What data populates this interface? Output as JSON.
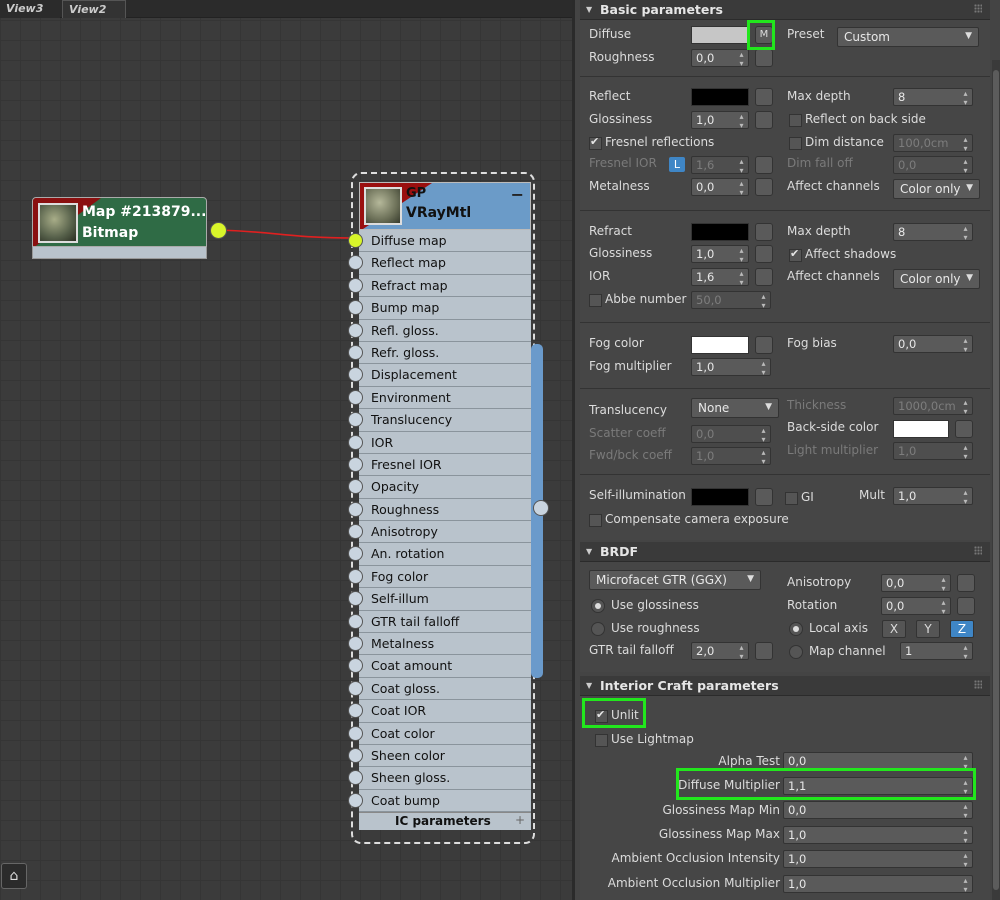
{
  "viewport_tabs": [
    "View3",
    "View2"
  ],
  "bitmap_node": {
    "title": "Map #213879...",
    "type": "Bitmap"
  },
  "vray_node": {
    "title": "GP",
    "type": "VRayMtl",
    "collapse_glyph": "−",
    "slots": [
      "Diffuse map",
      "Reflect map",
      "Refract map",
      "Bump map",
      "Refl. gloss.",
      "Refr. gloss.",
      "Displacement",
      "Environment",
      "Translucency",
      "IOR",
      "Fresnel IOR",
      "Opacity",
      "Roughness",
      "Anisotropy",
      "An. rotation",
      "Fog color",
      "Self-illum",
      "GTR tail falloff",
      "Metalness",
      "Coat amount",
      "Coat gloss.",
      "Coat IOR",
      "Coat color",
      "Sheen color",
      "Sheen gloss.",
      "Coat bump"
    ],
    "footer": "IC parameters",
    "footer_plus": "+"
  },
  "basic": {
    "title": "Basic parameters",
    "diffuse": "Diffuse",
    "m_button": "M",
    "preset": "Preset",
    "preset_value": "Custom",
    "roughness": "Roughness",
    "roughness_value": "0,0",
    "reflect": "Reflect",
    "max_depth": "Max depth",
    "max_depth_value": "8",
    "glossiness": "Glossiness",
    "glossiness_value": "1,0",
    "reflect_back": "Reflect on back side",
    "fresnel": "Fresnel reflections",
    "dim_distance": "Dim distance",
    "dim_distance_value": "100,0cm",
    "fresnel_ior": "Fresnel IOR",
    "l_button": "L",
    "fresnel_ior_value": "1,6",
    "dim_falloff": "Dim fall off",
    "dim_falloff_value": "0,0",
    "metalness": "Metalness",
    "metalness_value": "0,0",
    "affect_channels": "Affect channels",
    "affect_channels_value": "Color only",
    "refract": "Refract",
    "refr_max_depth": "Max depth",
    "refr_max_depth_value": "8",
    "refr_gloss": "Glossiness",
    "refr_gloss_value": "1,0",
    "affect_shadows": "Affect shadows",
    "ior": "IOR",
    "ior_value": "1,6",
    "refr_affect": "Affect channels",
    "refr_affect_value": "Color only",
    "abbe": "Abbe number",
    "abbe_value": "50,0",
    "fog_color": "Fog color",
    "fog_bias": "Fog bias",
    "fog_bias_value": "0,0",
    "fog_mult": "Fog multiplier",
    "fog_mult_value": "1,0",
    "translucency": "Translucency",
    "translucency_value": "None",
    "thickness": "Thickness",
    "thickness_value": "1000,0cm",
    "scatter": "Scatter coeff",
    "scatter_value": "0,0",
    "backside": "Back-side color",
    "fwdbck": "Fwd/bck coeff",
    "fwdbck_value": "1,0",
    "light_mult": "Light multiplier",
    "light_mult_value": "1,0",
    "self_illum": "Self-illumination",
    "gi": "GI",
    "mult": "Mult",
    "mult_value": "1,0",
    "compensate": "Compensate camera exposure"
  },
  "brdf": {
    "title": "BRDF",
    "type_value": "Microfacet GTR (GGX)",
    "anisotropy": "Anisotropy",
    "anisotropy_value": "0,0",
    "use_gloss": "Use glossiness",
    "rotation": "Rotation",
    "rotation_value": "0,0",
    "use_rough": "Use roughness",
    "local_axis": "Local axis",
    "x": "X",
    "y": "Y",
    "z": "Z",
    "gtr": "GTR tail falloff",
    "gtr_value": "2,0",
    "map_channel": "Map channel",
    "map_channel_value": "1"
  },
  "ic": {
    "title": "Interior Craft parameters",
    "unlit": "Unlit",
    "use_lightmap": "Use Lightmap",
    "alpha_test": "Alpha Test",
    "alpha_test_value": "0,0",
    "diffuse_mult": "Diffuse Multiplier",
    "diffuse_mult_value": "1,1",
    "gloss_min": "Glossiness Map Min",
    "gloss_min_value": "0,0",
    "gloss_max": "Glossiness Map Max",
    "gloss_max_value": "1,0",
    "ao_int": "Ambient Occlusion Intensity",
    "ao_int_value": "1,0",
    "ao_mult": "Ambient Occlusion Multiplier",
    "ao_mult_value": "1,0"
  },
  "colors": {
    "highlight": "#22e61d",
    "active_socket": "#d8f52a",
    "wire": "#e02020",
    "accent": "#3f86c6"
  }
}
